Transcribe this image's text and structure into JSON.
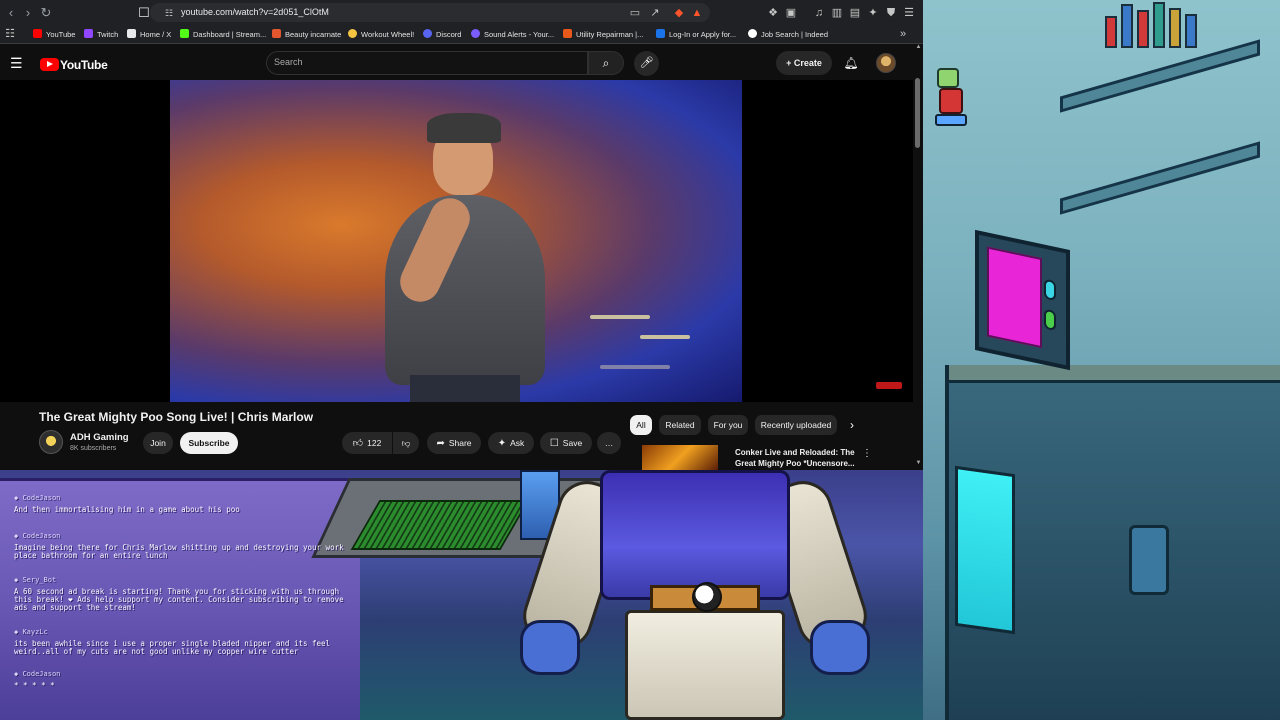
{
  "browser": {
    "url": "youtube.com/watch?v=2d051_ClOtM",
    "bookmarks": [
      {
        "label": "YouTube",
        "color": "#ff0000"
      },
      {
        "label": "Twitch",
        "color": "#9146ff"
      },
      {
        "label": "Home / X",
        "color": "#e7e9ea"
      },
      {
        "label": "Dashboard | Stream...",
        "color": "#53fc18"
      },
      {
        "label": "Beauty incarnate",
        "color": "#e2572e"
      },
      {
        "label": "Workout Wheel!",
        "color": "#f5c542"
      },
      {
        "label": "Discord",
        "color": "#5865f2"
      },
      {
        "label": "Sound Alerts - Your...",
        "color": "#7b5cff"
      },
      {
        "label": "Utility Repairman |...",
        "color": "#e8591a"
      },
      {
        "label": "Log-In or Apply for...",
        "color": "#1a73e8"
      },
      {
        "label": "Job Search | Indeed",
        "color": "#ffffff"
      }
    ],
    "more_bookmarks_icon": "chevron-right-double-icon"
  },
  "youtube": {
    "logo_text": "YouTube",
    "search_placeholder": "Search",
    "create_label": "Create",
    "video_title": "The Great Mighty Poo Song Live! | Chris Marlow",
    "channel": {
      "name": "ADH Gaming",
      "subscribers": "8K subscribers",
      "join_label": "Join",
      "subscribe_label": "Subscribe"
    },
    "actions": {
      "like_count": "122",
      "share_label": "Share",
      "ask_label": "Ask",
      "save_label": "Save"
    },
    "chips": [
      "All",
      "Related",
      "For you",
      "Recently uploaded"
    ],
    "active_chip": "All",
    "recommended": {
      "title": "Conker Live and Reloaded: The Great Mighty Poo *Uncensore..."
    }
  },
  "chat": [
    {
      "user": "CodeJason",
      "text": "And then immortalising him in a game about his poo"
    },
    {
      "user": "CodeJason",
      "text": "Imagine being there for Chris Marlow shitting up and destroying your work\nplace bathroom for an entire lunch"
    },
    {
      "user": "Sery_Bot",
      "text": "A 60 second ad break is starting! Thank you for sticking with us through\nthis break! ❤ Ads help support my content. Consider subscribing to remove\nads and support the stream!"
    },
    {
      "user": "KayzLc",
      "text": "its been awhile since i use a proper single bladed nipper and its feel\nweird..all of my cuts are not good unlike my copper wire cutter"
    },
    {
      "user": "CodeJason",
      "text": "* * * * *"
    }
  ],
  "colors": {
    "yt_bg": "#0f0f0f",
    "yt_red": "#ff0000",
    "chip_active_bg": "#f1f1f1",
    "tv_screen": "#e826d8"
  }
}
